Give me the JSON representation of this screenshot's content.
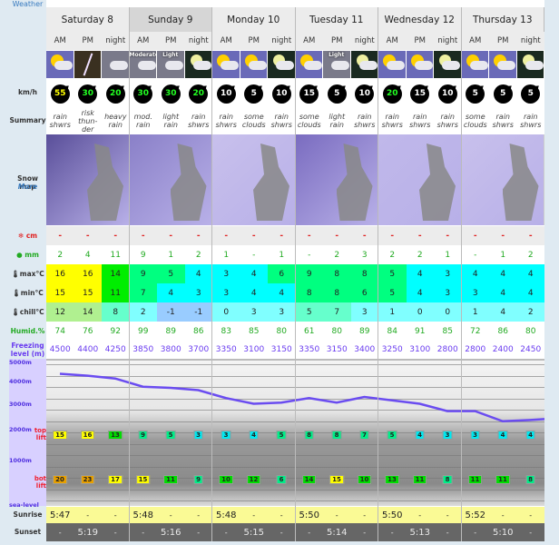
{
  "labels": {
    "weather": "Weather",
    "wind": "km/h",
    "summary": "Summary",
    "snowmap": "Snow map",
    "more": "More",
    "snow": "cm",
    "rain": "mm",
    "max": "max°C",
    "min": "min°C",
    "chill": "chill°C",
    "humid": "Humid.%",
    "freezing": "Freezing level (m)",
    "sunrise": "Sunrise",
    "sunset": "Sunset",
    "toplift": "top lift",
    "botlift": "bot lift",
    "axis": [
      "5000m",
      "4000m",
      "3000m",
      "2000m",
      "1000m",
      "sea-level"
    ]
  },
  "days": [
    "Saturday 8",
    "Sunday 9",
    "Monday 10",
    "Tuesday 11",
    "Wednesday 12",
    "Thursday 13"
  ],
  "periods": [
    "AM",
    "PM",
    "night",
    "AM",
    "PM",
    "night",
    "AM",
    "PM",
    "night",
    "AM",
    "PM",
    "night",
    "AM",
    "PM",
    "night",
    "AM",
    "PM",
    "night"
  ],
  "icons": [
    "sun-cloud-rain",
    "thunder",
    "heavy-rain",
    "moderate-rain",
    "light-rain",
    "moon-cloud-rain",
    "sun-cloud-rain",
    "sun-cloud",
    "moon-cloud-rain",
    "sun-cloud",
    "light-rain",
    "moon-cloud-rain",
    "sun-cloud-rain",
    "sun-cloud-rain",
    "moon-cloud-rain",
    "sun-cloud",
    "sun-cloud-rain",
    "moon-cloud-rain"
  ],
  "icon_text": {
    "3": "Moderate",
    "4": "Light",
    "10": "Light"
  },
  "wind": [
    "55",
    "30",
    "20",
    "30",
    "30",
    "20",
    "10",
    "5",
    "10",
    "15",
    "5",
    "10",
    "20",
    "15",
    "10",
    "5",
    "5",
    "5"
  ],
  "summary": [
    "rain\nshwrs",
    "risk\nthun-\nder",
    "heavy\nrain",
    "mod.\nrain",
    "light\nrain",
    "rain\nshwrs",
    "rain\nshwrs",
    "some\nclouds",
    "rain\nshwrs",
    "some\nclouds",
    "light\nrain",
    "rain\nshwrs",
    "rain\nshwrs",
    "rain\nshwrs",
    "rain\nshwrs",
    "some\nclouds",
    "rain\nshwrs",
    "rain\nshwrs"
  ],
  "snow": [
    "-",
    "-",
    "-",
    "-",
    "-",
    "-",
    "-",
    "-",
    "-",
    "-",
    "-",
    "-",
    "-",
    "-",
    "-",
    "-",
    "-",
    "-"
  ],
  "rain": [
    "2",
    "4",
    "11",
    "9",
    "1",
    "2",
    "1",
    "-",
    "1",
    "-",
    "2",
    "3",
    "2",
    "2",
    "1",
    "-",
    "1",
    "2"
  ],
  "max": [
    16,
    16,
    14,
    9,
    5,
    4,
    3,
    4,
    6,
    9,
    8,
    8,
    5,
    4,
    3,
    4,
    4,
    4
  ],
  "min": [
    15,
    15,
    11,
    7,
    4,
    3,
    3,
    4,
    4,
    8,
    8,
    6,
    5,
    4,
    3,
    3,
    4,
    4
  ],
  "chill": [
    12,
    14,
    8,
    2,
    -1,
    -1,
    0,
    3,
    3,
    5,
    7,
    3,
    1,
    0,
    0,
    1,
    4,
    2
  ],
  "humid": [
    "74",
    "76",
    "92",
    "99",
    "89",
    "86",
    "83",
    "85",
    "80",
    "61",
    "80",
    "89",
    "84",
    "91",
    "85",
    "72",
    "86",
    "80"
  ],
  "freezing": [
    4500,
    4400,
    4250,
    3850,
    3800,
    3700,
    3350,
    3100,
    3150,
    3350,
    3150,
    3400,
    3250,
    3100,
    2800,
    2800,
    2400,
    2450
  ],
  "top_lift": [
    15,
    16,
    13,
    9,
    5,
    3,
    3,
    4,
    5,
    8,
    8,
    7,
    5,
    4,
    3,
    3,
    4,
    4
  ],
  "bot_lift": [
    20,
    23,
    17,
    15,
    11,
    9,
    10,
    12,
    6,
    14,
    15,
    10,
    13,
    11,
    8,
    11,
    11,
    8
  ],
  "sunrise": [
    "5:47",
    "-",
    "-",
    "5:48",
    "-",
    "-",
    "5:48",
    "-",
    "-",
    "5:50",
    "-",
    "-",
    "5:50",
    "-",
    "-",
    "5:52",
    "-",
    "-"
  ],
  "sunset": [
    "-",
    "5:19",
    "-",
    "-",
    "5:16",
    "-",
    "-",
    "5:15",
    "-",
    "-",
    "5:14",
    "-",
    "-",
    "5:13",
    "-",
    "-",
    "5:10",
    "-"
  ],
  "colors": {
    "freezing_line": "#6a4cf0",
    "snow": "#e02020",
    "rain": "#22aa22",
    "humid": "#22aa22",
    "freezing_text": "#6a3cf0",
    "sunrise_bg": "#fafa95",
    "sunset_bg": "#666666"
  }
}
